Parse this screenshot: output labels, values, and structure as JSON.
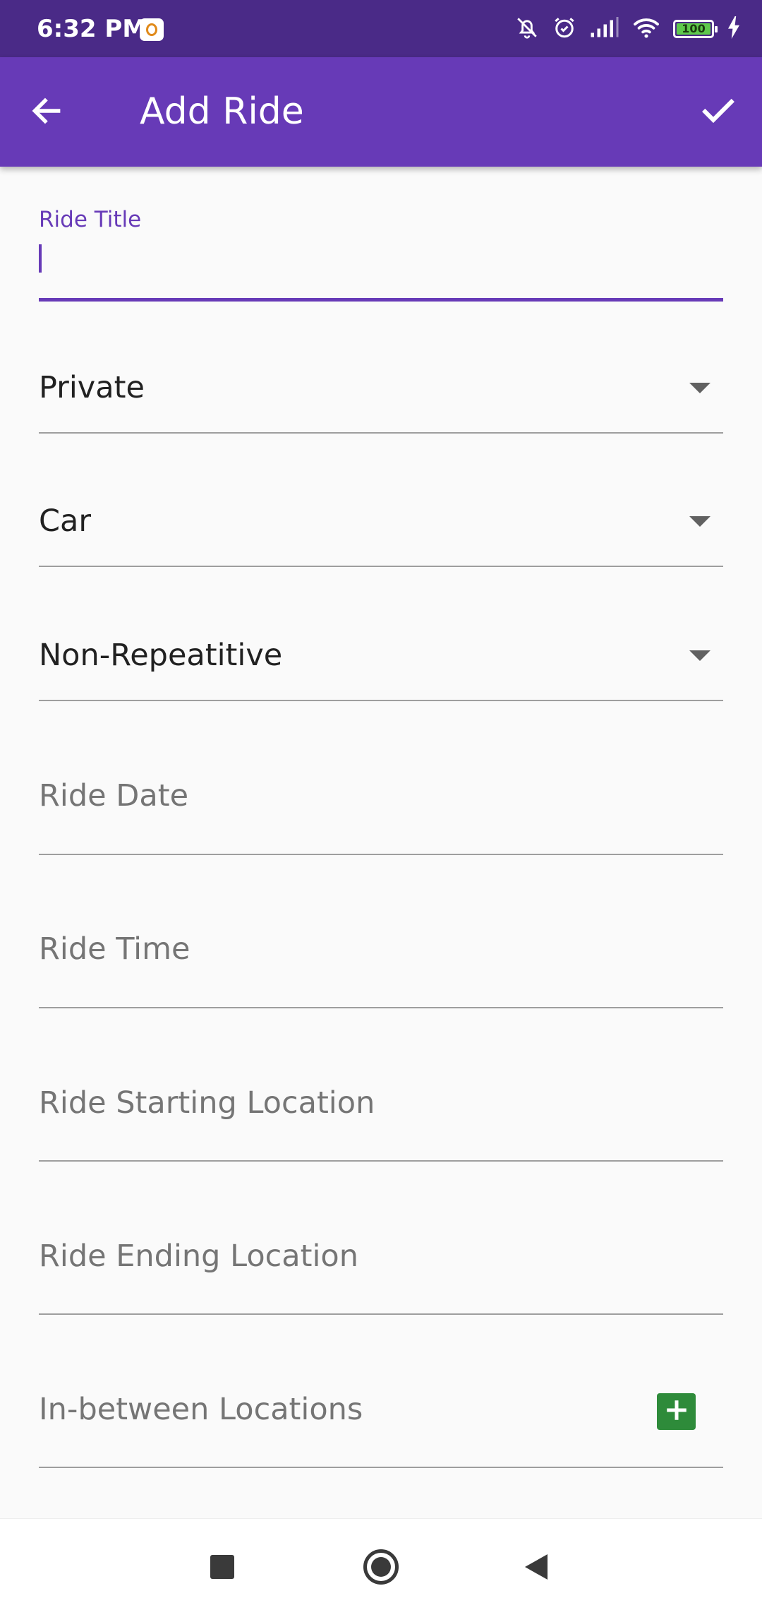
{
  "status_bar": {
    "time": "6:32 PM",
    "battery": "100",
    "icons": [
      "app-notification-icon",
      "bell-off-icon",
      "alarm-icon",
      "signal-icon",
      "wifi-icon",
      "battery-icon",
      "charging-icon"
    ]
  },
  "app_bar": {
    "title": "Add Ride",
    "back_icon": "arrow-left-icon",
    "confirm_icon": "check-icon",
    "color": "#673ab7"
  },
  "form": {
    "ride_title": {
      "label": "Ride Title",
      "value": ""
    },
    "visibility": {
      "selected": "Private"
    },
    "vehicle": {
      "selected": "Car"
    },
    "repeat": {
      "selected": "Non-Repeatitive"
    },
    "ride_date": {
      "hint": "Ride Date"
    },
    "ride_time": {
      "hint": "Ride Time"
    },
    "start_location": {
      "hint": "Ride Starting Location"
    },
    "end_location": {
      "hint": "Ride Ending Location"
    },
    "between_locations": {
      "hint": "In-between Locations",
      "add_icon": "plus-icon",
      "add_color": "#2e8b3a"
    }
  },
  "nav_bar": {
    "recents_icon": "square-icon",
    "home_icon": "circle-icon",
    "back_icon": "triangle-back-icon"
  }
}
